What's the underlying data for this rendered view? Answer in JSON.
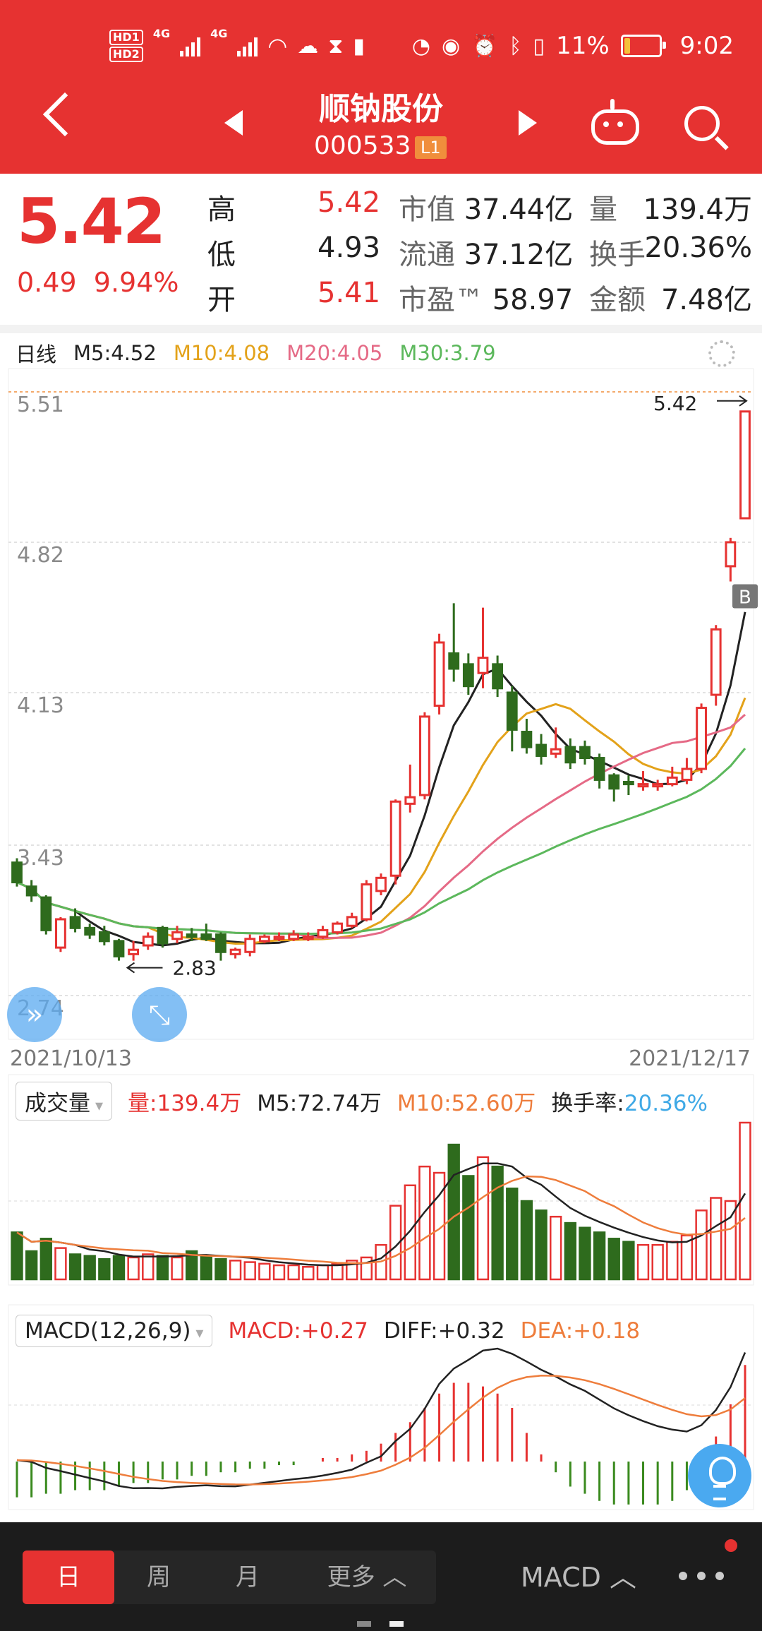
{
  "status_bar": {
    "left": [
      "HD1",
      "HD2",
      "4G",
      "4G"
    ],
    "battery": "11%",
    "time": "9:02"
  },
  "header": {
    "title": "顺钠股份",
    "code": "000533",
    "level_badge": "L1"
  },
  "quote": {
    "price": "5.42",
    "change": "0.49",
    "change_pct": "9.94%",
    "rows": [
      {
        "label": "高",
        "value": "5.42",
        "label2": "市值",
        "value2": "37.44亿",
        "label3": "量",
        "value3": "139.4万"
      },
      {
        "label": "低",
        "value": "4.93",
        "label2": "流通",
        "value2": "37.12亿",
        "label3": "换手",
        "value3": "20.36%"
      },
      {
        "label": "开",
        "value": "5.41",
        "label2": "市盈™",
        "value2": "58.97",
        "label3": "金额",
        "value3": "7.48亿"
      }
    ]
  },
  "kline": {
    "period_label": "日线",
    "ma": [
      {
        "label": "M5:4.52",
        "color": "#222222"
      },
      {
        "label": "M10:4.08",
        "color": "#e3a21a"
      },
      {
        "label": "M20:4.05",
        "color": "#e56a86"
      },
      {
        "label": "M30:3.79",
        "color": "#5cb85c"
      }
    ],
    "y_ticks": [
      "5.51",
      "4.82",
      "4.13",
      "3.43",
      "2.74"
    ],
    "high_marker": "5.42",
    "low_marker": "2.83",
    "buy_badge": "B",
    "date_start": "2021/10/13",
    "date_end": "2021/12/17"
  },
  "volume": {
    "selector": "成交量",
    "vol": "量:139.4万",
    "m5": "M5:72.74万",
    "m10": "M10:52.60万",
    "turnover_label": "换手率:",
    "turnover": "20.36%"
  },
  "macd": {
    "selector": "MACD(12,26,9)",
    "macd": "MACD:+0.27",
    "diff": "DIFF:+0.32",
    "dea": "DEA:+0.18"
  },
  "bottom_bar": {
    "tabs": [
      "日",
      "周",
      "月",
      "更多 ︿"
    ],
    "indicator": "MACD ︿"
  },
  "chart_data": {
    "type": "candlestick",
    "x_range": [
      "2021/10/13",
      "2021/12/17"
    ],
    "ylim": [
      2.74,
      5.51
    ],
    "candles": [
      {
        "o": 3.35,
        "c": 3.26,
        "h": 3.37,
        "l": 3.24
      },
      {
        "o": 3.24,
        "c": 3.2,
        "h": 3.27,
        "l": 3.17
      },
      {
        "o": 3.19,
        "c": 3.04,
        "h": 3.2,
        "l": 3.02
      },
      {
        "o": 2.96,
        "c": 3.09,
        "h": 3.1,
        "l": 2.94
      },
      {
        "o": 3.1,
        "c": 3.05,
        "h": 3.14,
        "l": 3.03
      },
      {
        "o": 3.05,
        "c": 3.02,
        "h": 3.07,
        "l": 3.0
      },
      {
        "o": 3.03,
        "c": 2.99,
        "h": 3.06,
        "l": 2.97
      },
      {
        "o": 2.99,
        "c": 2.92,
        "h": 3.0,
        "l": 2.9
      },
      {
        "o": 2.93,
        "c": 2.95,
        "h": 2.99,
        "l": 2.9
      },
      {
        "o": 2.97,
        "c": 3.01,
        "h": 3.03,
        "l": 2.95
      },
      {
        "o": 3.05,
        "c": 2.98,
        "h": 3.06,
        "l": 2.96
      },
      {
        "o": 3.0,
        "c": 3.03,
        "h": 3.06,
        "l": 2.98
      },
      {
        "o": 3.02,
        "c": 3.01,
        "h": 3.05,
        "l": 2.99
      },
      {
        "o": 3.02,
        "c": 3.0,
        "h": 3.07,
        "l": 2.99
      },
      {
        "o": 3.02,
        "c": 2.94,
        "h": 3.03,
        "l": 2.9
      },
      {
        "o": 2.93,
        "c": 2.95,
        "h": 2.96,
        "l": 2.91
      },
      {
        "o": 2.94,
        "c": 3.0,
        "h": 3.02,
        "l": 2.92
      },
      {
        "o": 2.99,
        "c": 3.01,
        "h": 3.02,
        "l": 2.98
      },
      {
        "o": 3.0,
        "c": 3.01,
        "h": 3.03,
        "l": 2.99
      },
      {
        "o": 3.0,
        "c": 3.02,
        "h": 3.04,
        "l": 2.99
      },
      {
        "o": 3.0,
        "c": 3.01,
        "h": 3.03,
        "l": 2.99
      },
      {
        "o": 3.01,
        "c": 3.04,
        "h": 3.06,
        "l": 3.0
      },
      {
        "o": 3.03,
        "c": 3.07,
        "h": 3.08,
        "l": 3.02
      },
      {
        "o": 3.06,
        "c": 3.1,
        "h": 3.12,
        "l": 3.05
      },
      {
        "o": 3.09,
        "c": 3.25,
        "h": 3.27,
        "l": 3.08
      },
      {
        "o": 3.22,
        "c": 3.28,
        "h": 3.3,
        "l": 3.2
      },
      {
        "o": 3.29,
        "c": 3.63,
        "h": 3.64,
        "l": 3.25
      },
      {
        "o": 3.62,
        "c": 3.65,
        "h": 3.8,
        "l": 3.58
      },
      {
        "o": 3.66,
        "c": 4.02,
        "h": 4.04,
        "l": 3.64
      },
      {
        "o": 4.07,
        "c": 4.36,
        "h": 4.4,
        "l": 4.03
      },
      {
        "o": 4.31,
        "c": 4.24,
        "h": 4.54,
        "l": 4.18
      },
      {
        "o": 4.26,
        "c": 4.16,
        "h": 4.31,
        "l": 4.12
      },
      {
        "o": 4.22,
        "c": 4.29,
        "h": 4.52,
        "l": 4.15
      },
      {
        "o": 4.26,
        "c": 4.15,
        "h": 4.3,
        "l": 4.11
      },
      {
        "o": 4.13,
        "c": 3.96,
        "h": 4.16,
        "l": 3.86
      },
      {
        "o": 3.95,
        "c": 3.88,
        "h": 4.01,
        "l": 3.85
      },
      {
        "o": 3.89,
        "c": 3.84,
        "h": 3.94,
        "l": 3.8
      },
      {
        "o": 3.85,
        "c": 3.87,
        "h": 3.97,
        "l": 3.83
      },
      {
        "o": 3.88,
        "c": 3.81,
        "h": 3.92,
        "l": 3.78
      },
      {
        "o": 3.88,
        "c": 3.83,
        "h": 3.91,
        "l": 3.8
      },
      {
        "o": 3.83,
        "c": 3.73,
        "h": 3.85,
        "l": 3.69
      },
      {
        "o": 3.75,
        "c": 3.69,
        "h": 3.76,
        "l": 3.63
      },
      {
        "o": 3.72,
        "c": 3.71,
        "h": 3.75,
        "l": 3.66
      },
      {
        "o": 3.7,
        "c": 3.71,
        "h": 3.77,
        "l": 3.68
      },
      {
        "o": 3.7,
        "c": 3.71,
        "h": 3.73,
        "l": 3.68
      },
      {
        "o": 3.71,
        "c": 3.74,
        "h": 3.79,
        "l": 3.7
      },
      {
        "o": 3.73,
        "c": 3.78,
        "h": 3.83,
        "l": 3.71
      },
      {
        "o": 3.78,
        "c": 4.06,
        "h": 4.08,
        "l": 3.76
      },
      {
        "o": 4.12,
        "c": 4.42,
        "h": 4.44,
        "l": 4.07
      },
      {
        "o": 4.71,
        "c": 4.82,
        "h": 4.84,
        "l": 4.64
      },
      {
        "o": 4.93,
        "c": 5.42,
        "h": 5.42,
        "l": 4.93
      }
    ],
    "ma_series": [
      {
        "name": "M5",
        "color": "#222222"
      },
      {
        "name": "M10",
        "color": "#e3a21a"
      },
      {
        "name": "M20",
        "color": "#e56a86"
      },
      {
        "name": "M30",
        "color": "#5cb85c"
      }
    ],
    "volume_series": [
      30,
      18,
      26,
      20,
      16,
      15,
      13,
      15,
      14,
      16,
      15,
      14,
      18,
      15,
      13,
      12,
      11,
      10,
      9,
      9,
      8,
      9,
      10,
      12,
      14,
      22,
      47,
      60,
      72,
      68,
      86,
      66,
      78,
      72,
      58,
      50,
      44,
      40,
      36,
      33,
      30,
      26,
      24,
      22,
      22,
      24,
      28,
      44,
      52,
      50,
      100
    ],
    "macd_hist": [
      -0.1,
      -0.1,
      -0.09,
      -0.09,
      -0.08,
      -0.08,
      -0.08,
      -0.07,
      -0.06,
      -0.06,
      -0.05,
      -0.05,
      -0.04,
      -0.04,
      -0.03,
      -0.03,
      -0.02,
      -0.02,
      -0.01,
      -0.01,
      0.0,
      0.01,
      0.01,
      0.02,
      0.03,
      0.05,
      0.08,
      0.11,
      0.15,
      0.19,
      0.22,
      0.22,
      0.21,
      0.19,
      0.15,
      0.08,
      0.02,
      -0.03,
      -0.07,
      -0.09,
      -0.11,
      -0.12,
      -0.12,
      -0.12,
      -0.12,
      -0.11,
      -0.08,
      -0.02,
      0.07,
      0.16,
      0.27
    ]
  }
}
